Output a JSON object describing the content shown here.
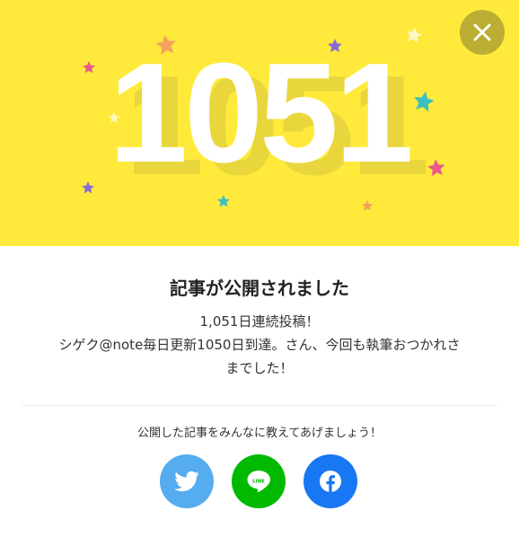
{
  "hero": {
    "streak_number": "1051",
    "colors": {
      "background": "#ffea3b",
      "number": "#ffffff",
      "shadow": "#e9d63d"
    },
    "stars": [
      {
        "color": "#f4a25c"
      },
      {
        "color": "#8b6ad6"
      },
      {
        "color": "#fff7c4"
      },
      {
        "color": "#e85a8a"
      },
      {
        "color": "#fff7c4"
      },
      {
        "color": "#3bbfbf"
      },
      {
        "color": "#3bbfbf"
      },
      {
        "color": "#3bbfbf"
      },
      {
        "color": "#e85a8a"
      },
      {
        "color": "#8b6ad6"
      },
      {
        "color": "#3bbfbf"
      },
      {
        "color": "#f4a25c"
      }
    ]
  },
  "close_button": {
    "icon": "close-icon"
  },
  "modal": {
    "title": "記事が公開されました",
    "message_line1": "1,051日連続投稿！",
    "message_line2": "シゲク@note毎日更新1050日到達。さん、今回も執筆おつかれさ",
    "message_line3": "までした！"
  },
  "share": {
    "prompt": "公開した記事をみんなに教えてあげましょう！",
    "buttons": [
      {
        "name": "twitter",
        "icon": "twitter-bird-icon",
        "color": "#55acee"
      },
      {
        "name": "line",
        "icon": "line-icon",
        "color": "#00b900",
        "label": "LINE"
      },
      {
        "name": "facebook",
        "icon": "facebook-icon",
        "color": "#1877f2"
      }
    ]
  }
}
